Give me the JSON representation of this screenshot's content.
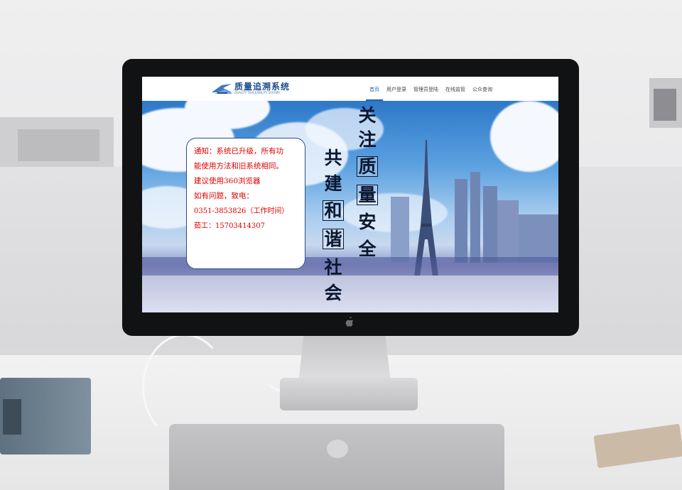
{
  "site": {
    "logo_title": "质量追溯系统",
    "logo_subtitle": "QUALITY TRACEABILITY SYSTEM"
  },
  "nav": {
    "items": [
      {
        "label": "首页",
        "active": true
      },
      {
        "label": "用户登录",
        "active": false
      },
      {
        "label": "管理员登陆",
        "active": false
      },
      {
        "label": "在线监管",
        "active": false
      },
      {
        "label": "公众查询",
        "active": false
      }
    ]
  },
  "notice": {
    "lines": [
      "通知：系统已升级，所有功",
      "能使用方法和旧系统相同。",
      "建议使用360浏览器",
      "如有问题，致电：",
      "0351-3853826（工作时间）",
      "茹工：15703414307"
    ]
  },
  "banner": {
    "slogan_right": [
      "关",
      "注",
      "质",
      "量",
      "安",
      "全"
    ],
    "slogan_left": [
      "共",
      "建",
      "和",
      "谐",
      "社",
      "会"
    ]
  },
  "colors": {
    "nav_active": "#1d63b3",
    "notice_text": "#e00000",
    "notice_border": "#2a4d8c",
    "logo_blue": "#1d4f8f"
  },
  "icons": {
    "logo_mark": "quality-logo-icon",
    "monitor_logo": "apple-logo-icon"
  }
}
